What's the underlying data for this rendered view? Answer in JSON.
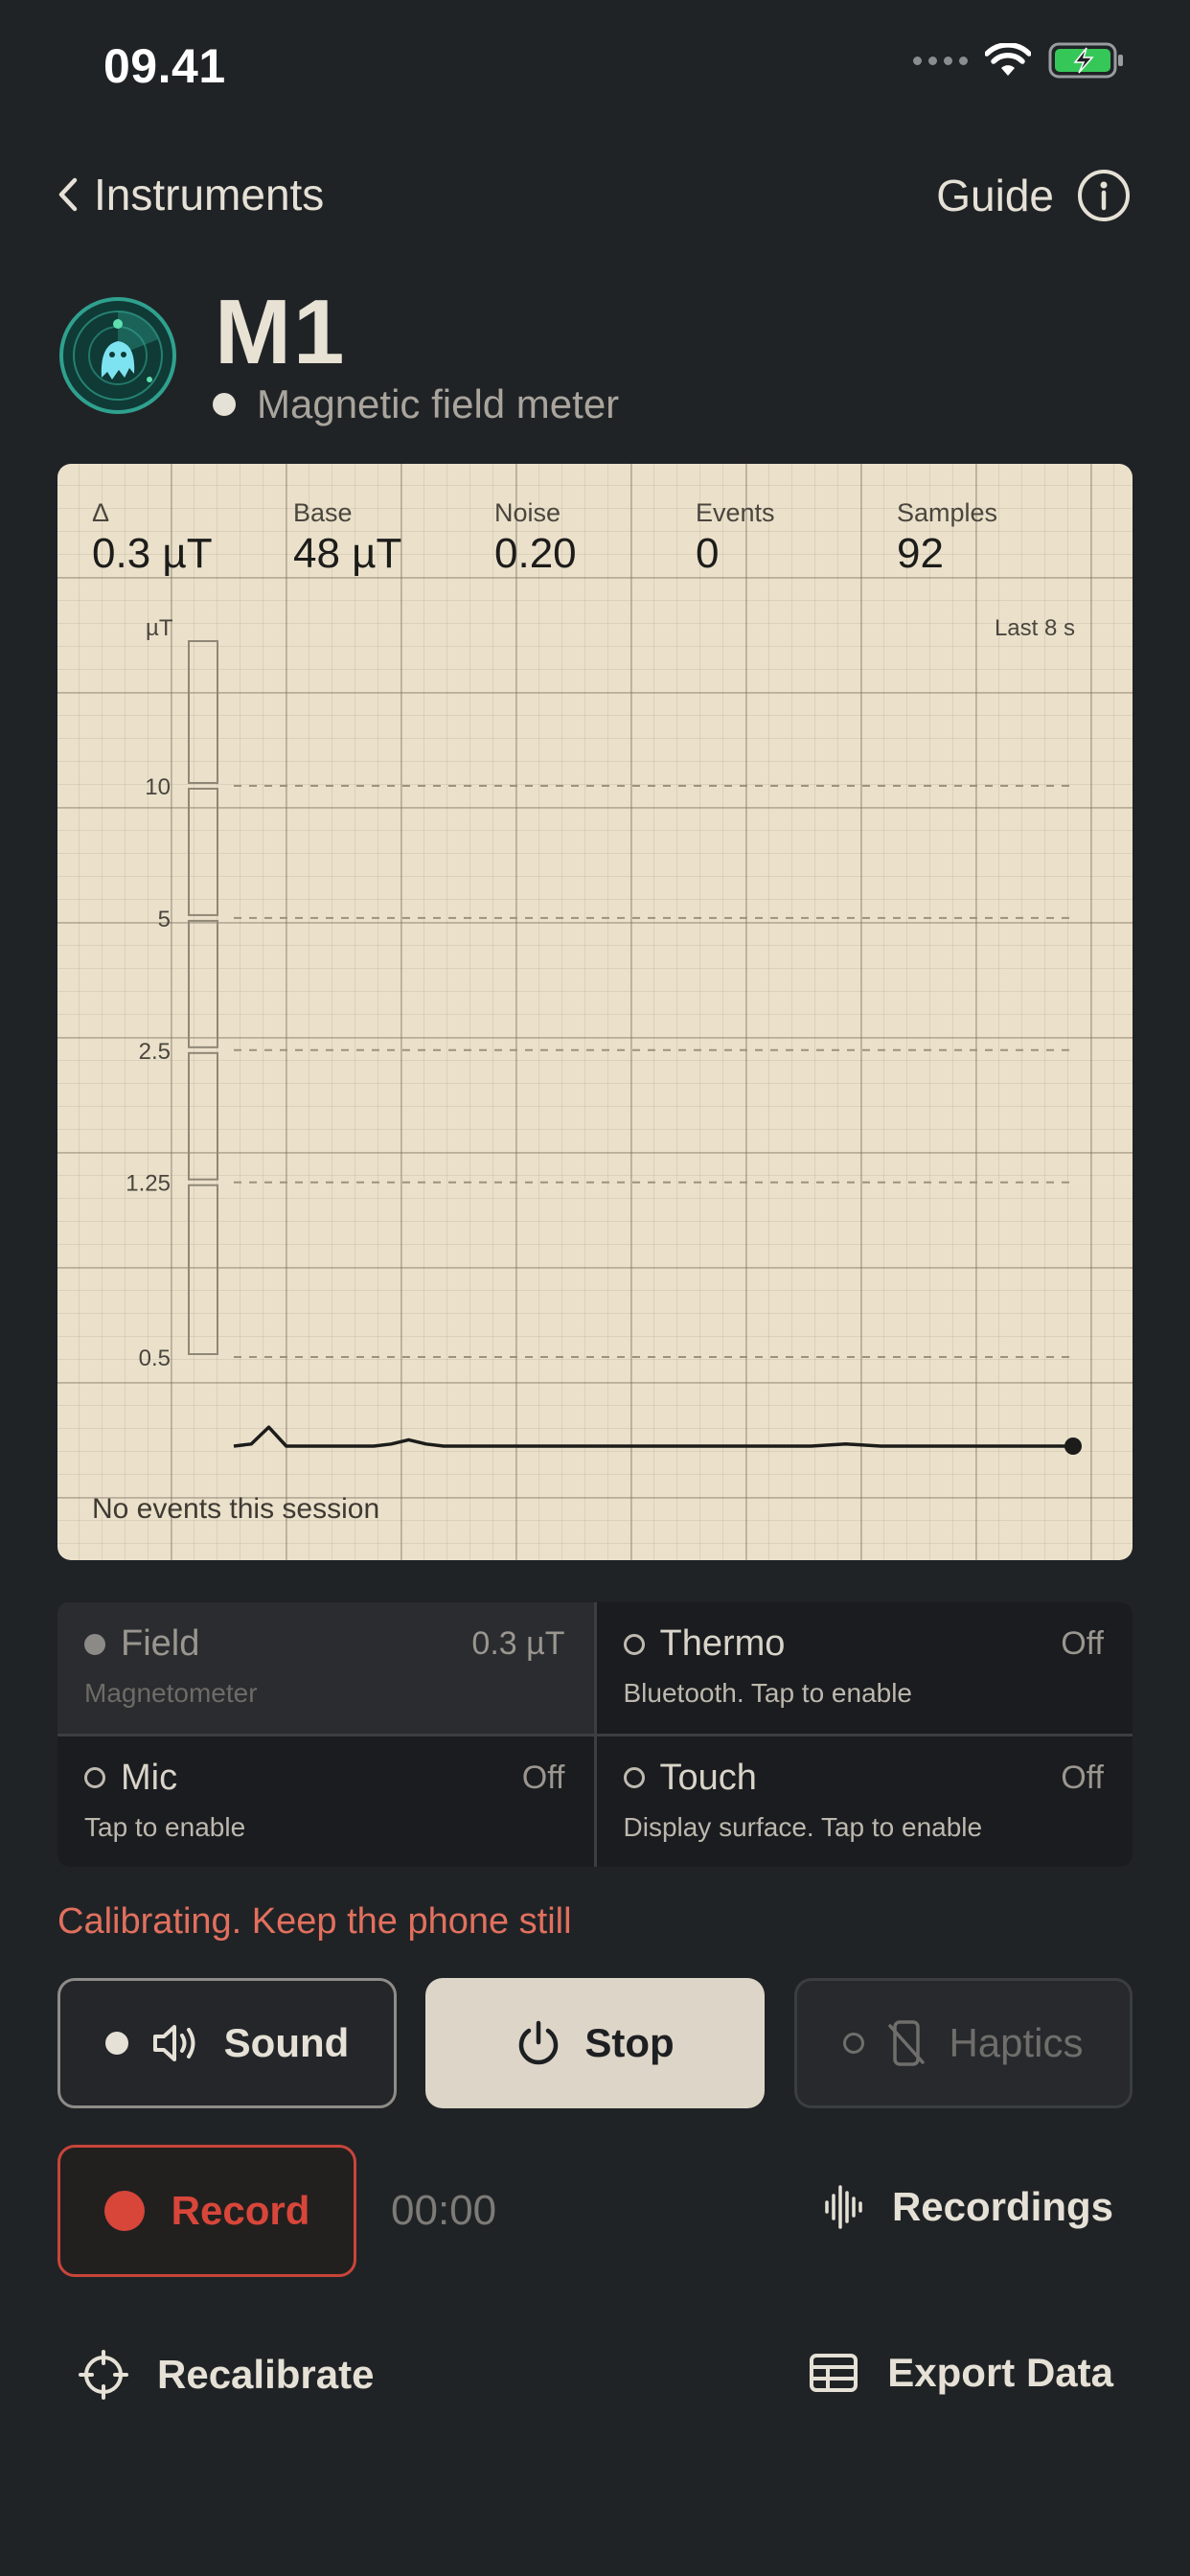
{
  "status_bar": {
    "time": "09.41"
  },
  "nav": {
    "back_label": "Instruments",
    "guide_label": "Guide"
  },
  "header": {
    "title": "M1",
    "subtitle": "Magnetic field meter"
  },
  "stats": [
    {
      "label": "Δ",
      "value": "0.3 µT"
    },
    {
      "label": "Base",
      "value": "48 µT"
    },
    {
      "label": "Noise",
      "value": "0.20"
    },
    {
      "label": "Events",
      "value": "0"
    },
    {
      "label": "Samples",
      "value": "92"
    }
  ],
  "chart": {
    "unit_label": "µT",
    "range_label": "Last 8 s",
    "footer": "No events this session"
  },
  "chart_data": {
    "type": "line",
    "y_tick_labels": [
      "10",
      "5",
      "2.5",
      "1.25",
      "0.5"
    ],
    "y_scale": "log",
    "x_range_seconds": [
      0,
      8
    ],
    "series": [
      {
        "values": [
          0.1,
          0.12,
          0.28,
          0.1,
          0.1,
          0.1,
          0.1,
          0.1,
          0.1,
          0.12,
          0.16,
          0.12,
          0.1,
          0.1,
          0.1,
          0.1,
          0.1,
          0.1,
          0.1,
          0.1,
          0.1,
          0.1,
          0.1,
          0.1,
          0.1,
          0.1,
          0.1,
          0.1,
          0.1,
          0.1,
          0.1,
          0.1,
          0.1,
          0.1,
          0.11,
          0.12,
          0.11,
          0.1,
          0.1,
          0.1,
          0.1,
          0.1,
          0.1,
          0.1,
          0.1,
          0.1,
          0.1,
          0.1,
          0.1
        ]
      }
    ],
    "grid": true
  },
  "sensors": [
    {
      "name": "Field",
      "value": "0.3 µT",
      "sub": "Magnetometer",
      "active": true
    },
    {
      "name": "Thermo",
      "value": "Off",
      "sub": "Bluetooth. Tap to enable",
      "active": false
    },
    {
      "name": "Mic",
      "value": "Off",
      "sub": "Tap to enable",
      "active": false
    },
    {
      "name": "Touch",
      "value": "Off",
      "sub": "Display surface. Tap to enable",
      "active": false
    }
  ],
  "calibration_status": "Calibrating. Keep the phone still",
  "controls": {
    "sound_label": "Sound",
    "stop_label": "Stop",
    "haptics_label": "Haptics"
  },
  "recording": {
    "record_label": "Record",
    "timer": "00:00",
    "recordings_label": "Recordings"
  },
  "actions": {
    "recalibrate_label": "Recalibrate",
    "export_label": "Export Data"
  },
  "colors": {
    "background": "#202326",
    "panel": "#ebe1cb",
    "record_red": "#d8463a",
    "calibration_text": "#e2705e",
    "logo_teal": "#2fa18f"
  },
  "icons": [
    "wifi-icon",
    "battery-charging-icon",
    "chevron-left-icon",
    "info-icon",
    "ghost-radar-logo",
    "speaker-icon",
    "power-icon",
    "no-phone-icon",
    "waveform-icon",
    "crosshair-icon",
    "table-icon"
  ]
}
